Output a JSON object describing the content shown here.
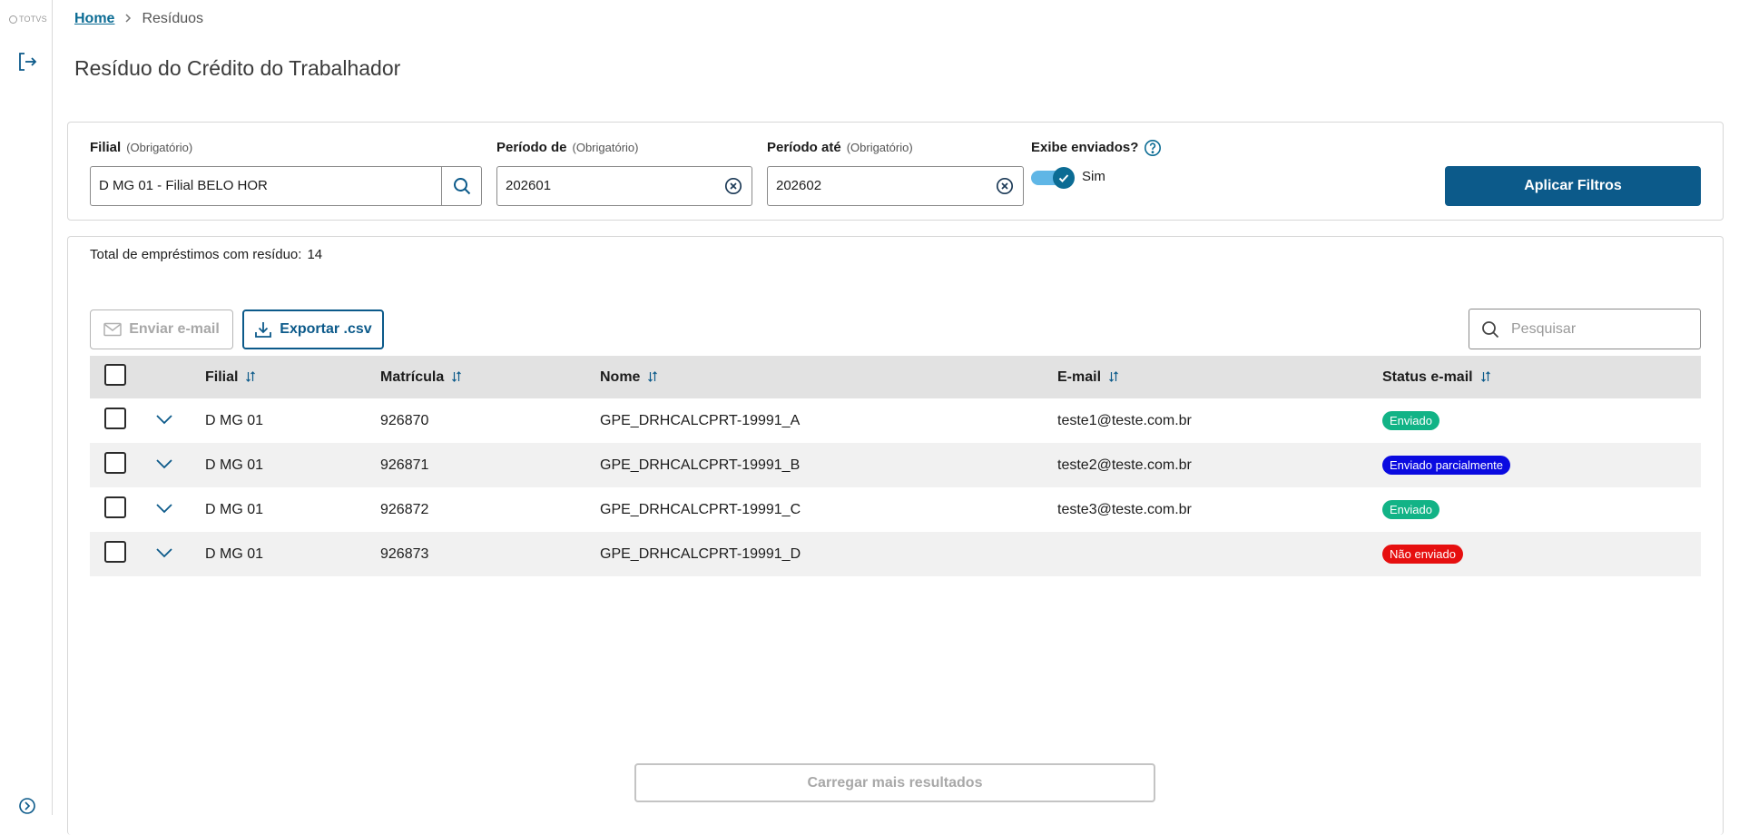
{
  "sidebar": {
    "logo_text": "TOTVS",
    "logout_icon": "logout-icon",
    "expand_icon": "chevron-right-circle-icon"
  },
  "breadcrumb": {
    "home": "Home",
    "current": "Resíduos"
  },
  "page": {
    "title": "Resíduo do Crédito do Trabalhador"
  },
  "filters": {
    "filial": {
      "label": "Filial",
      "hint": "(Obrigatório)",
      "value": "D MG 01 - Filial BELO HOR"
    },
    "periodo_de": {
      "label": "Período de",
      "hint": "(Obrigatório)",
      "value": "202601"
    },
    "periodo_ate": {
      "label": "Período até",
      "hint": "(Obrigatório)",
      "value": "202602"
    },
    "exibe_enviados": {
      "label": "Exibe enviados?",
      "toggle_label": "Sim",
      "checked": true
    },
    "apply_label": "Aplicar Filtros"
  },
  "results": {
    "total_label": "Total de empréstimos com resíduo:",
    "total_value": "14",
    "send_email_label": "Enviar e-mail",
    "export_label": "Exportar .csv",
    "search_placeholder": "Pesquisar",
    "columns": [
      "Filial",
      "Matrícula",
      "Nome",
      "E-mail",
      "Status e-mail"
    ],
    "rows": [
      {
        "filial": "D MG 01",
        "matricula": "926870",
        "nome": "GPE_DRHCALCPRT-19991_A",
        "email": "teste1@teste.com.br",
        "status": "Enviado",
        "status_color": "#12b386"
      },
      {
        "filial": "D MG 01",
        "matricula": "926871",
        "nome": "GPE_DRHCALCPRT-19991_B",
        "email": "teste2@teste.com.br",
        "status": "Enviado parcialmente",
        "status_color": "#0a0ae0"
      },
      {
        "filial": "D MG 01",
        "matricula": "926872",
        "nome": "GPE_DRHCALCPRT-19991_C",
        "email": "teste3@teste.com.br",
        "status": "Enviado",
        "status_color": "#12b386"
      },
      {
        "filial": "D MG 01",
        "matricula": "926873",
        "nome": "GPE_DRHCALCPRT-19991_D",
        "email": "",
        "status": "Não enviado",
        "status_color": "#e60f0f"
      }
    ],
    "load_more_label": "Carregar mais resultados"
  },
  "colors": {
    "primary": "#0c5a8a",
    "link": "#0c6c94",
    "toggle_track": "#5fb6e6"
  }
}
